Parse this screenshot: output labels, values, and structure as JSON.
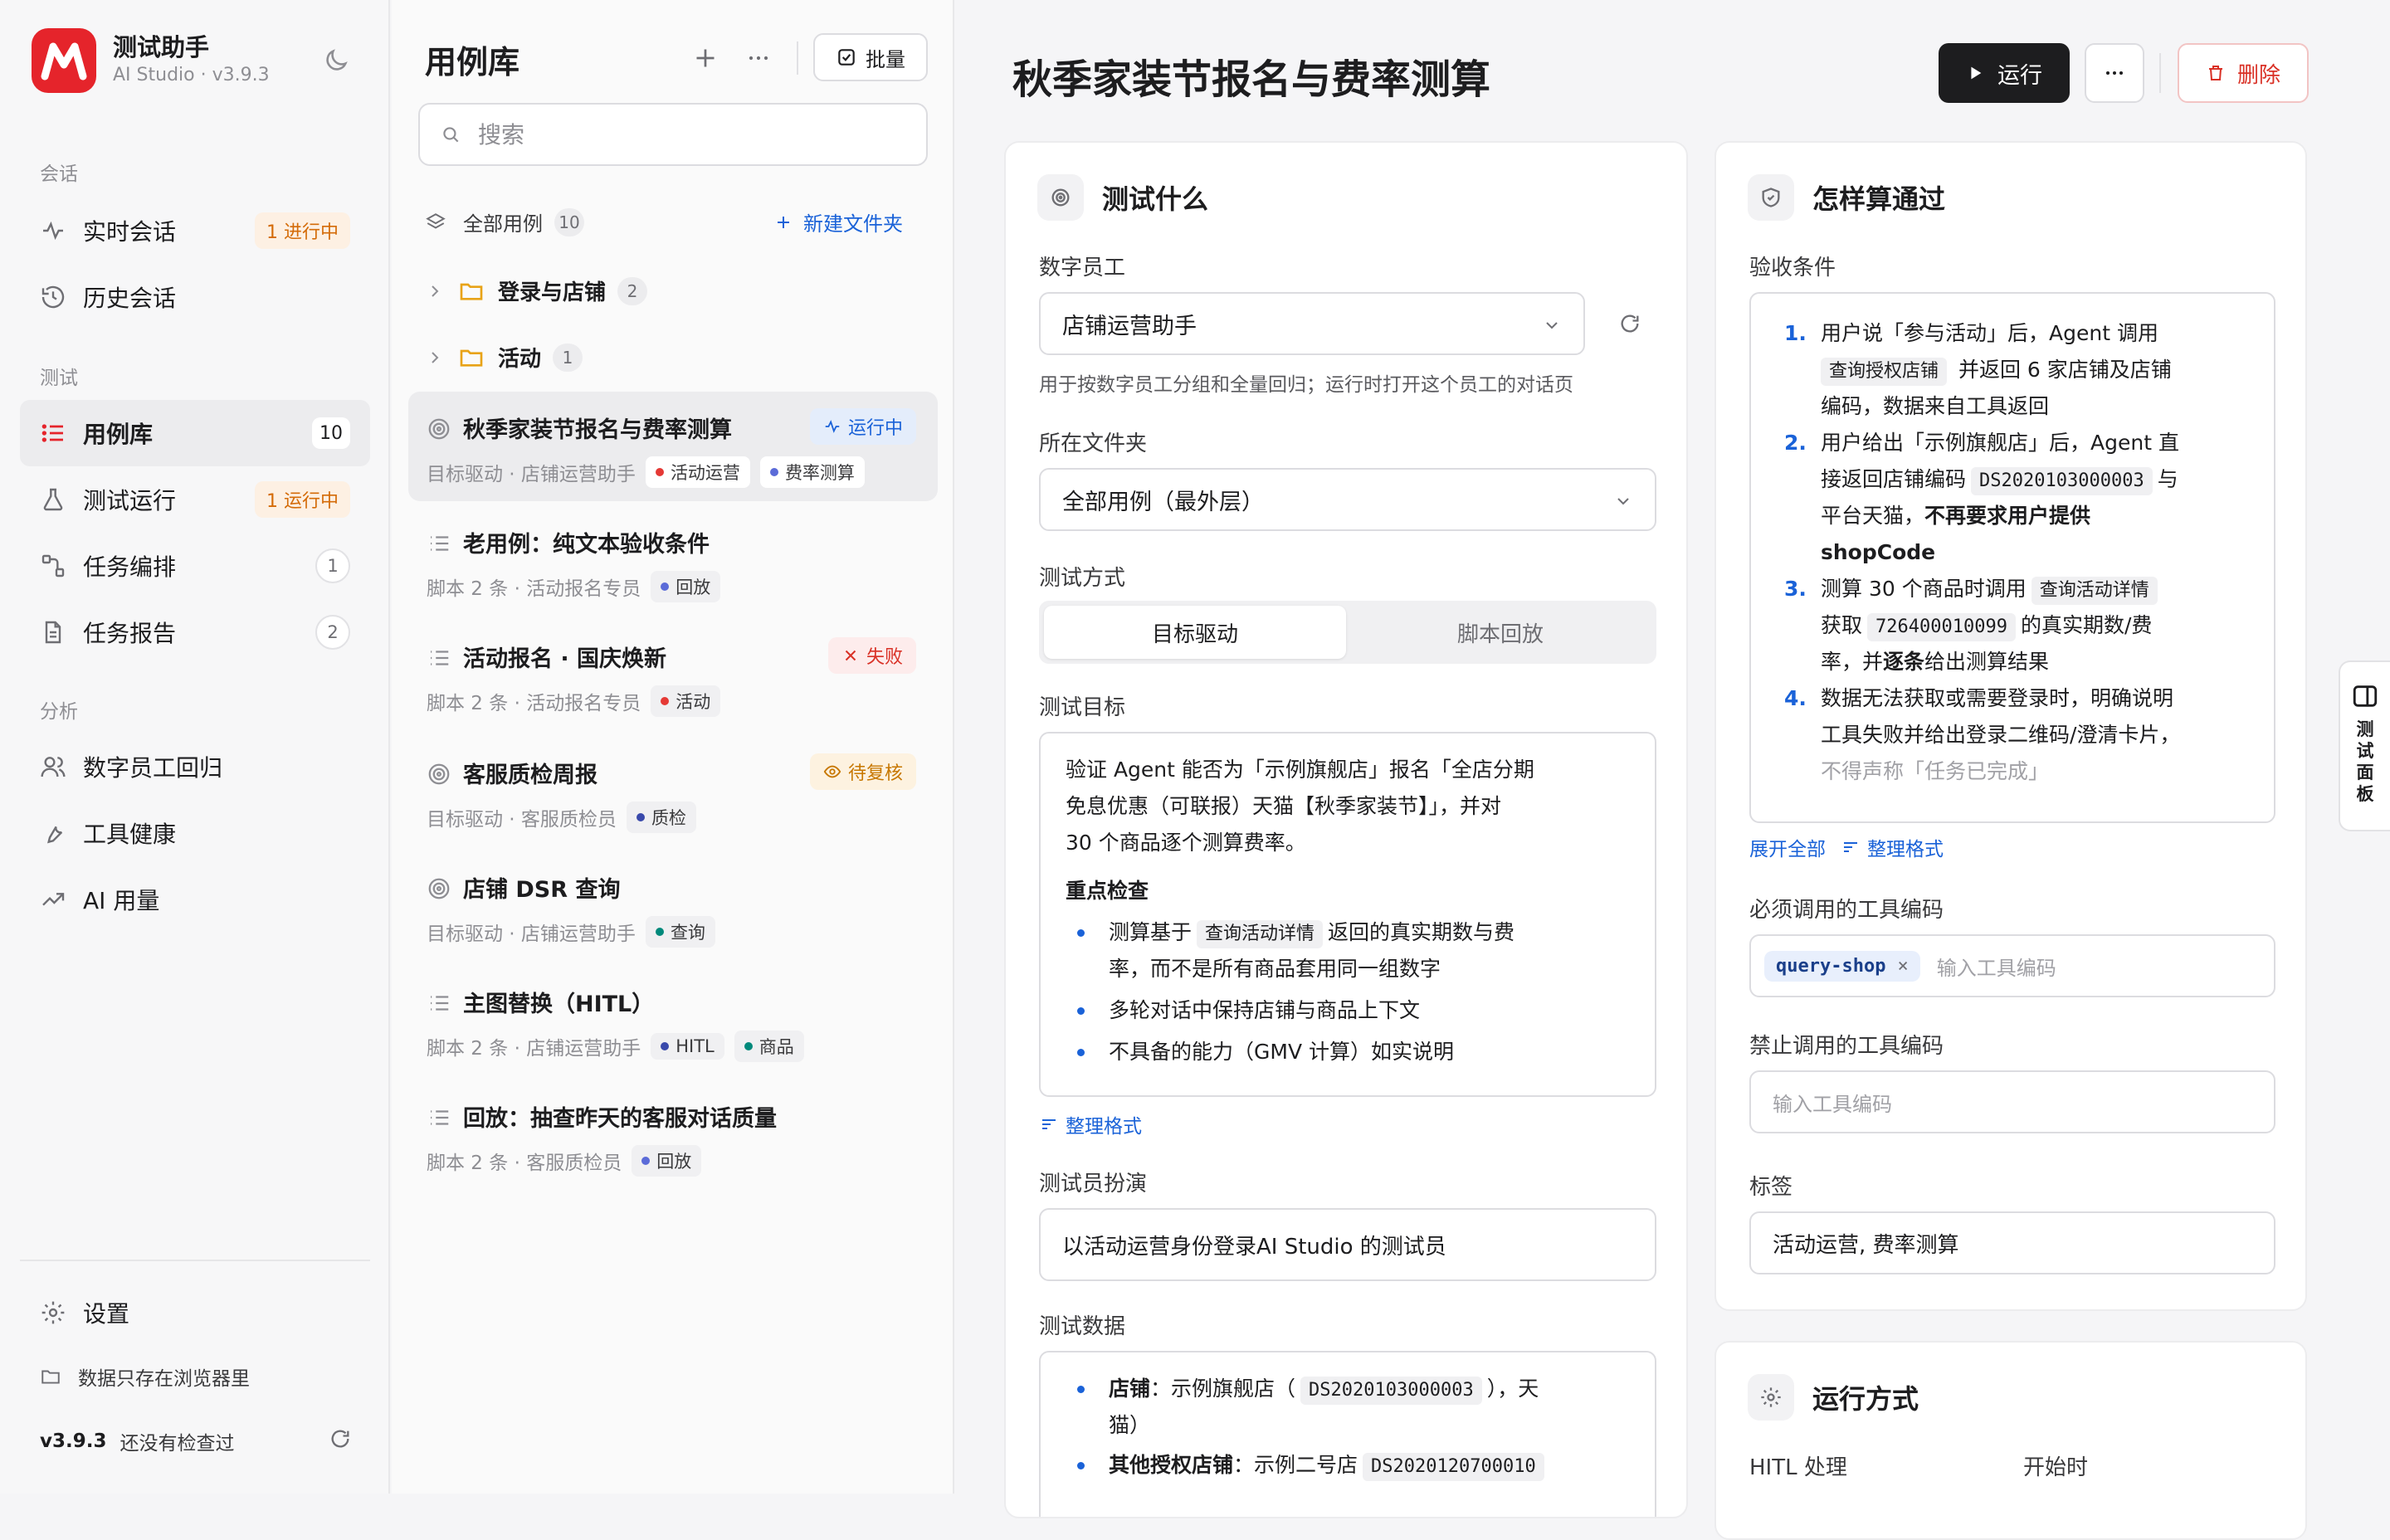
{
  "app": {
    "name": "测试助手",
    "subtitle": "AI Studio · v3.9.3"
  },
  "sidebar": {
    "sections": {
      "conversation": "会话",
      "testing": "测试",
      "analysis": "分析"
    },
    "items": [
      {
        "label": "实时会话",
        "badge": "1 进行中"
      },
      {
        "label": "历史会话"
      },
      {
        "label": "用例库",
        "badge": "10"
      },
      {
        "label": "测试运行",
        "badge": "1 运行中"
      },
      {
        "label": "任务编排",
        "badge": "1"
      },
      {
        "label": "任务报告",
        "badge": "2"
      },
      {
        "label": "数字员工回归"
      },
      {
        "label": "工具健康"
      },
      {
        "label": "AI 用量"
      }
    ],
    "settings": "设置",
    "storage_note": "数据只存在浏览器里",
    "version": "v3.9.3",
    "update_status": "还没有检查过"
  },
  "library": {
    "title": "用例库",
    "batch_label": "批量",
    "search_placeholder": "搜索",
    "all_cases": {
      "label": "全部用例",
      "count": "10"
    },
    "new_folder": "新建文件夹",
    "folders": [
      {
        "name": "登录与店铺",
        "count": "2"
      },
      {
        "name": "活动",
        "count": "1"
      }
    ],
    "cases": [
      {
        "title": "秋季家装节报名与费率测算",
        "meta": "目标驱动 · 店铺运营助手",
        "tags": [
          "活动运营",
          "费率测算"
        ],
        "status": "运行中"
      },
      {
        "title": "老用例：纯文本验收条件",
        "meta": "脚本 2 条 · 活动报名专员",
        "tags": [
          "回放"
        ],
        "status": ""
      },
      {
        "title": "活动报名 · 国庆焕新",
        "meta": "脚本 2 条 · 活动报名专员",
        "tags": [
          "活动"
        ],
        "status": "失败"
      },
      {
        "title": "客服质检周报",
        "meta": "目标驱动 · 客服质检员",
        "tags": [
          "质检"
        ],
        "status": "待复核"
      },
      {
        "title": "店铺 DSR 查询",
        "meta": "目标驱动 · 店铺运营助手",
        "tags": [
          "查询"
        ],
        "status": ""
      },
      {
        "title": "主图替换（HITL）",
        "meta": "脚本 2 条 · 店铺运营助手",
        "tags": [
          "HITL",
          "商品"
        ],
        "status": ""
      },
      {
        "title": "回放：抽查昨天的客服对话质量",
        "meta": "脚本 2 条 · 客服质检员",
        "tags": [
          "回放"
        ],
        "status": ""
      }
    ]
  },
  "main": {
    "title": "秋季家装节报名与费率测算",
    "run_label": "运行",
    "delete_label": "删除",
    "what": {
      "title": "测试什么",
      "employee_label": "数字员工",
      "employee_value": "店铺运营助手",
      "employee_hint": "用于按数字员工分组和全量回归；运行时打开这个员工的对话页",
      "folder_label": "所在文件夹",
      "folder_value": "全部用例（最外层）",
      "mode_label": "测试方式",
      "mode_options": [
        "目标驱动",
        "脚本回放"
      ],
      "goal_label": "测试目标",
      "goal_lines": [
        "验证 Agent 能否为「示例旗舰店」报名「全店分期",
        "免息优惠（可联报）天猫【秋季家装节】」，并对",
        "30 个商品逐个测算费率。"
      ],
      "focus_title": "重点检查",
      "focus": {
        "b1_pre": "测算基于",
        "b1_code": "查询活动详情",
        "b1_post": "返回的真实期数与费",
        "b1_line2": "率，而不是所有商品套用同一组数字",
        "b2": "多轮对话中保持店铺与商品上下文",
        "b3": "不具备的能力（GMV 计算）如实说明"
      },
      "format_label": "整理格式",
      "persona_label": "测试员扮演",
      "persona_value": "以活动运营身份登录AI Studio 的测试员",
      "data_label": "测试数据",
      "data": {
        "shop_key": "店铺",
        "shop_pre": "：示例旗舰店（",
        "shop_code": "DS2020103000003",
        "shop_post": "），天",
        "shop_line2": "猫）",
        "other_key": "其他授权店铺",
        "other_pre": "：示例二号店",
        "other_code": "DS2020120700010"
      }
    },
    "pass": {
      "title": "怎样算通过",
      "criteria_label": "验收条件",
      "criteria": {
        "c1_l1": "用户说「参与活动」后，Agent 调用",
        "c1_code": "查询授权店铺",
        "c1_l2": "并返回 6 家店铺及店铺",
        "c1_l3": "编码，数据来自工具返回",
        "c2_l1": "用户给出「示例旗舰店」后，Agent 直",
        "c2_pre": "接返回店铺编码",
        "c2_code": "DS2020103000003",
        "c2_post": "与",
        "c2_l3_pre": "平台天猫，",
        "c2_l3_bold": "不再要求用户提供",
        "c2_l4": "shopCode",
        "c3_pre": "测算 30 个商品时调用",
        "c3_code": "查询活动详情",
        "c3_l2_pre": "获取",
        "c3_l2_code": "726400010099",
        "c3_l2_post": "的真实期数/费",
        "c3_l3_pre": "率，并",
        "c3_l3_bold": "逐条",
        "c3_l3_post": "给出测算结果",
        "c4_l1": "数据无法获取或需要登录时，明确说明",
        "c4_l2": "工具失败并给出登录二维码/澄清卡片，",
        "c4_l3": "不得声称「任务已完成」"
      },
      "expand_label": "展开全部",
      "format_label": "整理格式",
      "required_tools_label": "必须调用的工具编码",
      "required_tools": [
        "query-shop"
      ],
      "tool_placeholder": "输入工具编码",
      "forbidden_tools_label": "禁止调用的工具编码",
      "tags_label": "标签",
      "tags_value": "活动运营, 费率测算"
    },
    "run_mode": {
      "title": "运行方式",
      "hitl_label": "HITL 处理",
      "start_label": "开始时"
    },
    "side_tab": "测试面板"
  },
  "colors": {
    "brand": "#e5242b",
    "accent": "#1a62d8",
    "run_button": "#1d1d1f",
    "danger": "#d93025",
    "warning": "#d46b08"
  }
}
